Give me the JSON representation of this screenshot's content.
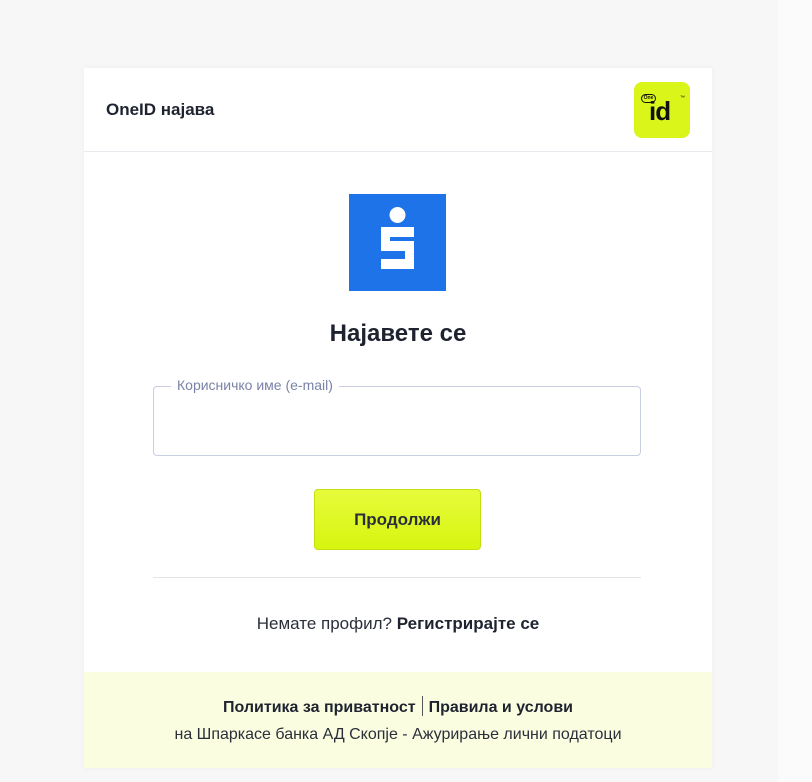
{
  "header": {
    "title": "OneID најава",
    "logo_badge": "One",
    "logo_text": "id",
    "logo_tm": "™",
    "logo_icon": "oneid-logo"
  },
  "bank": {
    "logo_icon": "sparkasse-logo",
    "logo_color": "#1e73e8"
  },
  "form": {
    "heading": "Најавете се",
    "username_label": "Корисничко име (е-mail)",
    "username_value": "",
    "continue_label": "Продолжи"
  },
  "register": {
    "prompt": "Немате профил?",
    "link": "Регистрирајте се"
  },
  "footer": {
    "privacy_link": "Политика за приватност",
    "terms_link": "Правила и услови",
    "note": "на Шпаркасе банка АД Скопје - Ажурирање лични податоци"
  },
  "colors": {
    "accent": "#d9f51a",
    "footer_bg": "#fafde0",
    "bank_blue": "#1e73e8"
  }
}
